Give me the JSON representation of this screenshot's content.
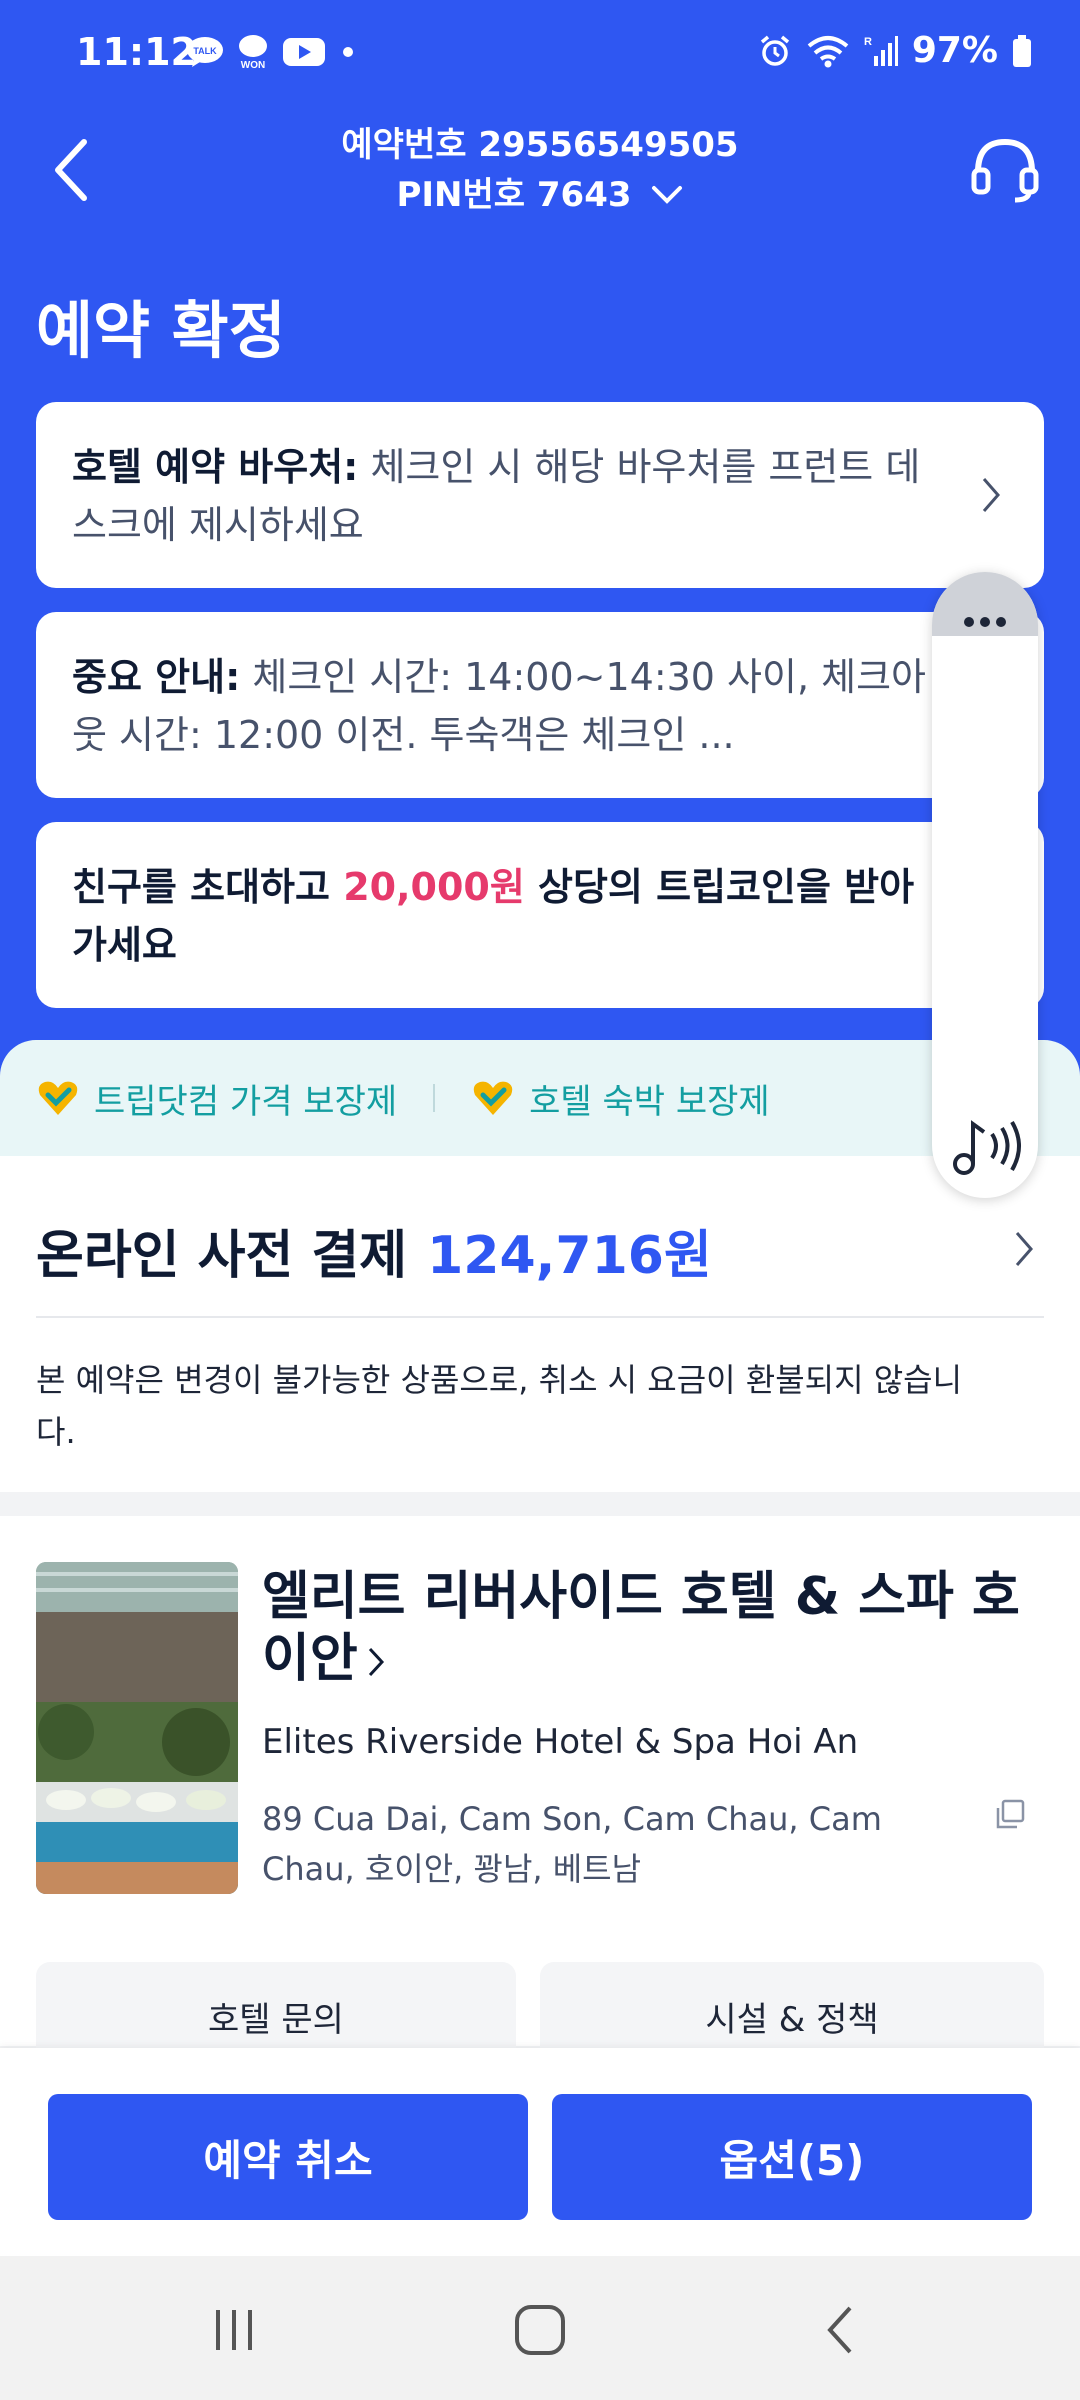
{
  "status_bar": {
    "time": "11:12",
    "apps": [
      "talk-icon",
      "won-icon",
      "youtube-icon"
    ],
    "battery": "97%"
  },
  "header": {
    "booking_no": "예약번호 29556549505",
    "pin": "PIN번호 7643"
  },
  "page_title": "예약 확정",
  "cards": {
    "voucher": {
      "head": "호텔 예약 바우처:",
      "text": " 체크인 시 해당 바우처를 프런트 데스크에 제시하세요"
    },
    "notice": {
      "head": "중요 안내:",
      "text": " 체크인 시간: 14:00~14:30 사이, 체크아웃 시간: 12:00 이전. 투숙객은 체크인 ..."
    },
    "invite": {
      "pre": "친구를 초대하고 ",
      "amount": "20,000원",
      "post": " 상당의 트립코인을 받아가세요"
    }
  },
  "guarantee": {
    "item1": "트립닷컴 가격 보장제",
    "item2": "호텔 숙박 보장제",
    "accent": "#139ea1"
  },
  "payment": {
    "label": "온라인 사전 결제",
    "amount": "124,716원",
    "note": "본 예약은 변경이 불가능한 상품으로, 취소 시 요금이 환불되지 않습니다."
  },
  "hotel": {
    "name": "엘리트 리버사이드 호텔 & 스파 호이안",
    "name_en": "Elites Riverside Hotel & Spa Hoi An",
    "address": "89 Cua Dai, Cam Son, Cam Chau, Cam Chau, 호이안, 꽝남, 베트남",
    "inquiry_label": "호텔 문의",
    "facility_label": "시설 & 정책"
  },
  "actions": {
    "cancel_label": "예약 취소",
    "options_label": "옵션(5)"
  },
  "colors": {
    "primary": "#2f57f2",
    "highlight": "#e63a6c"
  }
}
